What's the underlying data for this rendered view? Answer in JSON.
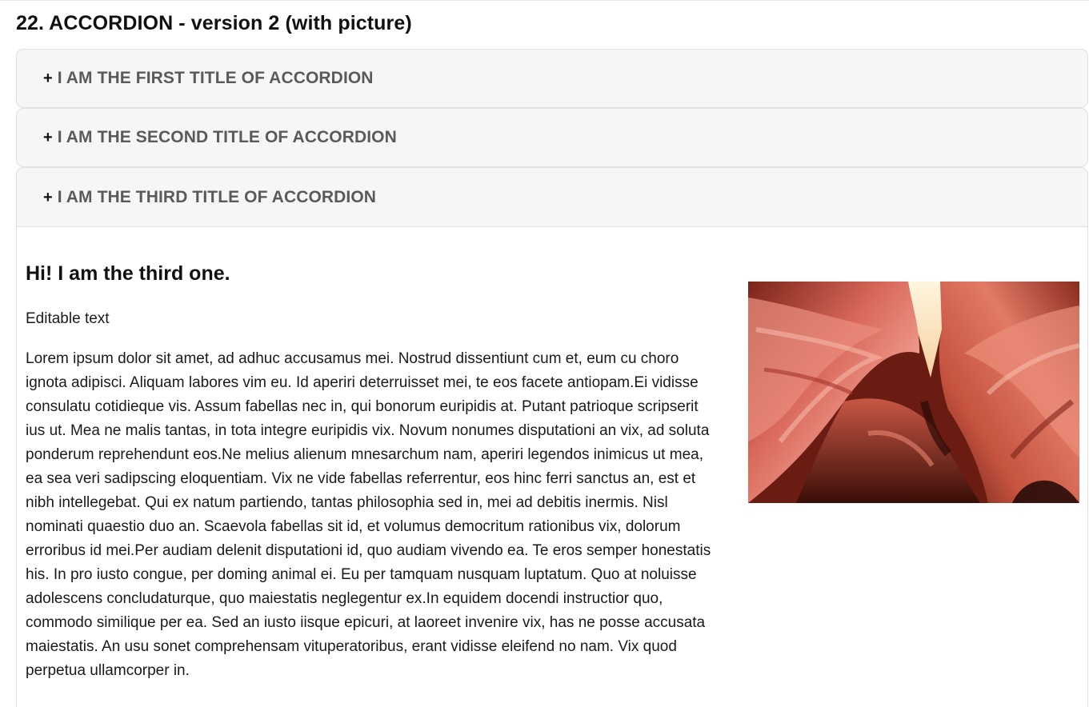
{
  "section": {
    "title": "22. ACCORDION - version 2 (with picture)"
  },
  "accordion": {
    "items": [
      {
        "icon": "plus-icon",
        "symbol": "+",
        "title": "I AM THE FIRST TITLE OF ACCORDION",
        "expanded": false
      },
      {
        "icon": "plus-icon",
        "symbol": "+",
        "title": "I AM THE SECOND TITLE OF ACCORDION",
        "expanded": false
      },
      {
        "icon": "plus-icon",
        "symbol": "+",
        "title": "I AM THE THIRD TITLE OF ACCORDION",
        "expanded": true
      }
    ],
    "panel": {
      "heading": "Hi! I am the third one.",
      "subtitle": "Editable text",
      "body": "Lorem ipsum dolor sit amet, ad adhuc accusamus mei. Nostrud dissentiunt cum et, eum cu choro ignota adipisci. Aliquam labores vim eu. Id aperiri deterruisset mei, te eos facete antiopam.Ei vidisse consulatu cotidieque vis. Assum fabellas nec in, qui bonorum euripidis at. Putant patrioque scripserit ius ut. Mea ne malis tantas, in tota integre euripidis vix. Novum nonumes disputationi an vix, ad soluta ponderum reprehendunt eos.Ne melius alienum mnesarchum nam, aperiri legendos inimicus ut mea, ea sea veri sadipscing eloquentiam. Vix ne vide fabellas referrentur, eos hinc ferri sanctus an, est et nibh intellegebat. Qui ex natum partiendo, tantas philosophia sed in, mei ad debitis inermis. Nisl nominati quaestio duo an. Scaevola fabellas sit id, et volumus democritum rationibus vix, dolorum erroribus id mei.Per audiam delenit disputationi id, quo audiam vivendo ea. Te eros semper honestatis his. In pro iusto congue, per doming animal ei. Eu per tamquam nusquam luptatum. Quo at noluisse adolescens concludaturque, quo maiestatis neglegentur ex.In equidem docendi instructior quo, commodo similique per ea. Sed an iusto iisque epicuri, at laoreet invenire vix, has ne posse accusata maiestatis. An usu sonet comprehensam vituperatoribus, erant vidisse eleifend no nam. Vix quod perpetua ullamcorper in."
    }
  },
  "colors": {
    "header_bg": "#f6f6f6",
    "border": "#e1e1e1",
    "title_text": "#5a5a5a",
    "heading_text": "#111111"
  }
}
